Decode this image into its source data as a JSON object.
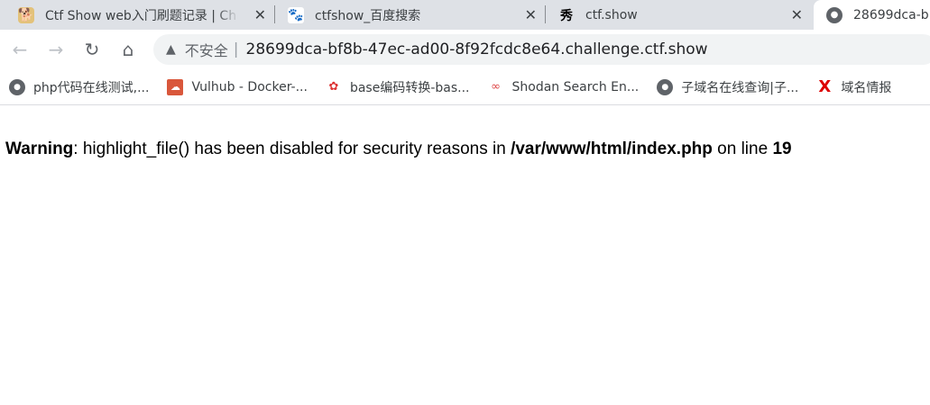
{
  "tabs": [
    {
      "title": "Ctf Show web入门刷题记录 | Ch",
      "icon": "dog-icon"
    },
    {
      "title": "ctfshow_百度搜索",
      "icon": "baidu-icon"
    },
    {
      "title": "ctf.show",
      "icon": "ctfshow-icon"
    },
    {
      "title": "28699dca-b",
      "icon": "globe-icon",
      "active": true
    }
  ],
  "address": {
    "security": "不安全",
    "url": "28699dca-bf8b-47ec-ad00-8f92fcdc8e64.challenge.ctf.show"
  },
  "bookmarks": [
    {
      "label": "php代码在线测试,...",
      "icon": "globe-icon"
    },
    {
      "label": "Vulhub - Docker-...",
      "icon": "vulhub-icon"
    },
    {
      "label": "base编码转换-bas...",
      "icon": "base-icon"
    },
    {
      "label": "Shodan Search En...",
      "icon": "shodan-icon"
    },
    {
      "label": "子域名在线查询|子...",
      "icon": "globe-icon"
    },
    {
      "label": "域名情报",
      "icon": "x-icon"
    }
  ],
  "page": {
    "warning_label": "Warning",
    "message": ": highlight_file() has been disabled for security reasons in ",
    "file": "/var/www/html/index.php",
    "on_line": " on line ",
    "line": "19"
  }
}
